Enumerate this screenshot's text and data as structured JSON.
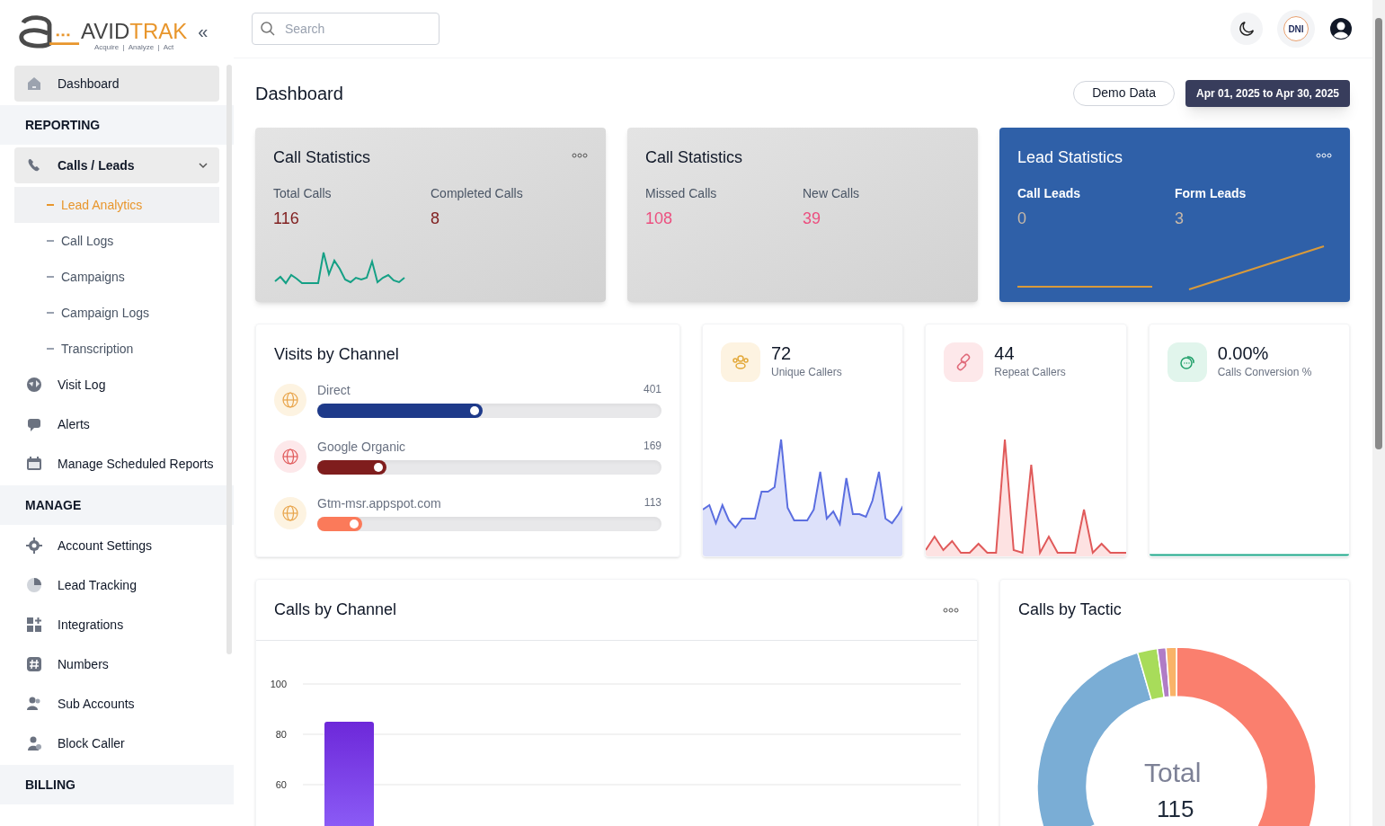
{
  "logo": {
    "brand_dark": "AVID",
    "brand_accent": "TRAK",
    "tagline": "Acquire  |  Analyze  |  Act"
  },
  "sidebar": {
    "collapse_glyph": "«",
    "items": [
      {
        "kind": "item",
        "label": "Dashboard",
        "selected": true
      },
      {
        "kind": "section",
        "label": "REPORTING"
      },
      {
        "kind": "group",
        "label": "Calls / Leads",
        "expanded": true,
        "children": [
          {
            "label": "Lead Analytics",
            "selected": true
          },
          {
            "label": "Call Logs",
            "selected": false
          },
          {
            "label": "Campaigns",
            "selected": false
          },
          {
            "label": "Campaign Logs",
            "selected": false
          },
          {
            "label": "Transcription",
            "selected": false
          }
        ]
      },
      {
        "kind": "item",
        "label": "Visit Log",
        "selected": false
      },
      {
        "kind": "item",
        "label": "Alerts",
        "selected": false
      },
      {
        "kind": "item",
        "label": "Manage Scheduled Reports",
        "selected": false
      },
      {
        "kind": "section",
        "label": "MANAGE"
      },
      {
        "kind": "item",
        "label": "Account Settings",
        "selected": false
      },
      {
        "kind": "item",
        "label": "Lead Tracking",
        "selected": false
      },
      {
        "kind": "item",
        "label": "Integrations",
        "selected": false
      },
      {
        "kind": "item",
        "label": "Numbers",
        "selected": false
      },
      {
        "kind": "item",
        "label": "Sub Accounts",
        "selected": false
      },
      {
        "kind": "item",
        "label": "Block Caller",
        "selected": false
      },
      {
        "kind": "section",
        "label": "BILLING"
      }
    ]
  },
  "header": {
    "search": {
      "placeholder": "Search"
    },
    "badge": "DNI"
  },
  "page": {
    "title": "Dashboard",
    "demo_button": "Demo Data",
    "date_range": "Apr 01, 2025 to Apr 30, 2025"
  },
  "stat_cards": [
    {
      "kind": "calls",
      "title": "Call Statistics",
      "menu": true,
      "metrics": [
        {
          "label": "Total Calls",
          "value": "116"
        },
        {
          "label": "Completed Calls",
          "value": "8"
        }
      ]
    },
    {
      "kind": "missed",
      "title": "Call Statistics",
      "menu": false,
      "metrics": [
        {
          "label": "Missed Calls",
          "value": "108"
        },
        {
          "label": "New Calls",
          "value": "39"
        }
      ]
    },
    {
      "kind": "leads",
      "title": "Lead Statistics",
      "menu": true,
      "metrics": [
        {
          "label": "Call Leads",
          "value": "0"
        },
        {
          "label": "Form Leads",
          "value": "3"
        }
      ]
    }
  ],
  "visits": {
    "title": "Visits by Channel",
    "channels": [
      {
        "name": "Direct",
        "count": "401",
        "level": 0.48,
        "color": "#1e3a8a"
      },
      {
        "name": "Google Organic",
        "count": "169",
        "level": 0.2,
        "color": "#7f1d1d"
      },
      {
        "name": "Gtm-msr.appspot.com",
        "count": "113",
        "level": 0.13,
        "color": "#fb7a5a"
      }
    ]
  },
  "kpis": [
    {
      "kind": "users",
      "value": "72",
      "label": "Unique Callers"
    },
    {
      "kind": "link",
      "value": "44",
      "label": "Repeat Callers"
    },
    {
      "kind": "chat",
      "value": "0.00%",
      "label": "Calls Conversion %"
    }
  ],
  "calls_by_channel": {
    "title": "Calls by Channel",
    "chart_data": {
      "type": "bar",
      "values": [
        85
      ],
      "ylim": [
        0,
        100
      ],
      "yticks": [
        60,
        80,
        100
      ]
    }
  },
  "calls_by_tactic": {
    "title": "Calls by Tactic",
    "center_label": "Total",
    "center_value": "115"
  }
}
